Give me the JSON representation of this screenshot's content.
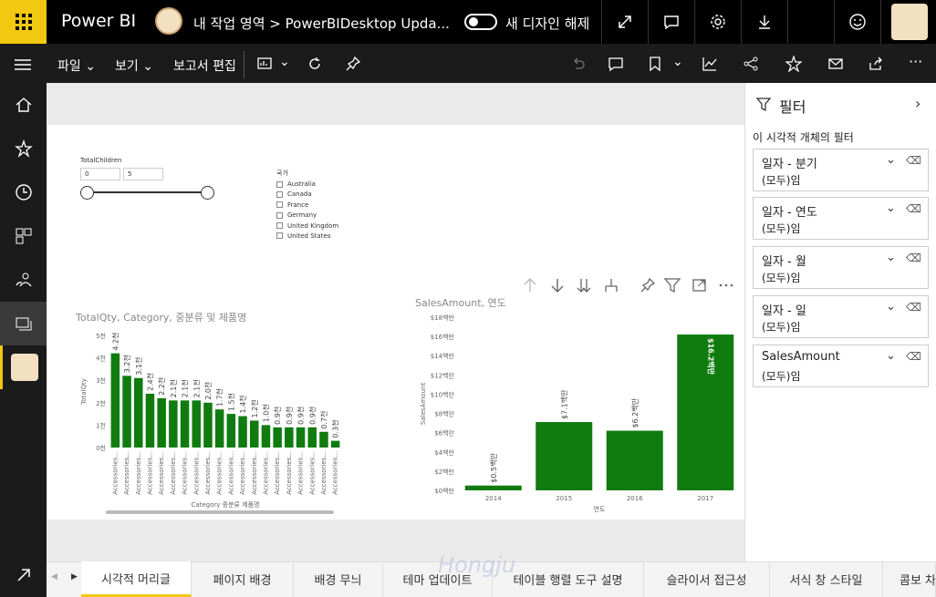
{
  "topbar": {
    "app_title": "Power BI",
    "breadcrumb": "내 작업 영역 > PowerBIDesktop Upda...",
    "toggle_label": "새 디자인 해제"
  },
  "commands": {
    "file": "파일",
    "view": "보기",
    "edit": "보고서 편집"
  },
  "slicer": {
    "title": "TotalChildren",
    "min": "0",
    "max": "5"
  },
  "country_slicer": {
    "title": "국가",
    "options": [
      "Australia",
      "Canada",
      "France",
      "Germany",
      "United Kingdom",
      "United States"
    ]
  },
  "chart_data": [
    {
      "type": "bar",
      "title": "TotalQty, Category, 중분류 및 제품명",
      "xlabel": "Category 중분류 제품명",
      "ylabel": "TotalQty",
      "yticks": [
        "0천",
        "1천",
        "2천",
        "3천",
        "4천",
        "5천"
      ],
      "ylim": [
        0,
        5000
      ],
      "color": "#107c10",
      "categories": [
        "Accessories...",
        "Accessories...",
        "Accessories...",
        "Accessories...",
        "Accessories...",
        "Accessories...",
        "Accessories...",
        "Accessories...",
        "Accessories...",
        "Accessories...",
        "Accessories...",
        "Accessories...",
        "Accessories...",
        "Accessories...",
        "Accessories...",
        "Accessories...",
        "Accessories...",
        "Accessories...",
        "Accessories...",
        "Accessories..."
      ],
      "values": [
        4200,
        3200,
        3100,
        2400,
        2200,
        2100,
        2100,
        2100,
        2000,
        1700,
        1500,
        1400,
        1200,
        1000,
        900,
        900,
        900,
        900,
        700,
        300
      ],
      "labels": [
        "4.2천",
        "3.2천",
        "3.1천",
        "2.4천",
        "2.2천",
        "2.1천",
        "2.1천",
        "2.1천",
        "2.0천",
        "1.7천",
        "1.5천",
        "1.4천",
        "1.2천",
        "1.0천",
        "0.9천",
        "0.9천",
        "0.9천",
        "0.9천",
        "0.7천",
        "0.3천"
      ]
    },
    {
      "type": "bar",
      "title": "SalesAmount, 연도",
      "xlabel": "연도",
      "ylabel": "SalesAmount",
      "yticks": [
        "$0백만",
        "$2백만",
        "$4백만",
        "$6백만",
        "$8백만",
        "$10백만",
        "$12백만",
        "$14백만",
        "$16백만",
        "$18백만"
      ],
      "ylim": [
        0,
        18
      ],
      "color": "#107c10",
      "categories": [
        "2014",
        "2015",
        "2016",
        "2017"
      ],
      "values": [
        0.5,
        7.1,
        6.2,
        16.2
      ],
      "labels": [
        "$0.5백만",
        "$7.1백만",
        "$6.2백만",
        "$16.2백만"
      ]
    }
  ],
  "filters": {
    "title": "필터",
    "section": "이 시각적 개체의 필터",
    "cards": [
      {
        "name": "일자 - 분기",
        "value": "(모두)임"
      },
      {
        "name": "일자 - 연도",
        "value": "(모두)임"
      },
      {
        "name": "일자 - 월",
        "value": "(모두)임"
      },
      {
        "name": "일자 - 일",
        "value": "(모두)임"
      },
      {
        "name": "SalesAmount",
        "value": "(모두)임"
      }
    ]
  },
  "tabs": [
    "시각적 머리글",
    "페이지 배경",
    "배경 무늬",
    "테마 업데이트",
    "테이블 행렬 도구 설명",
    "슬라이서 접근성",
    "서식 창 스타일",
    "콤보 차"
  ],
  "watermark": "Hongju"
}
